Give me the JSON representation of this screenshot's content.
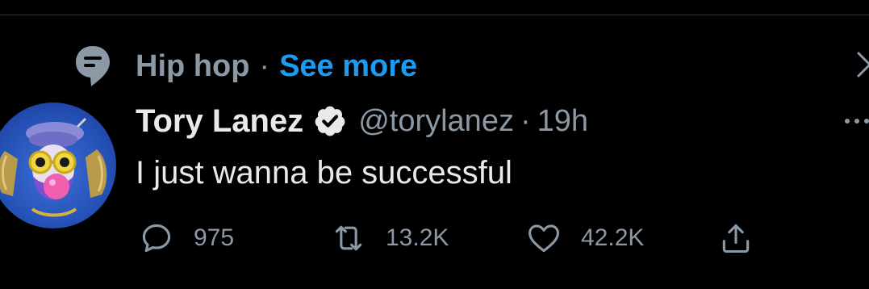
{
  "topic": {
    "name": "Hip hop",
    "separator": "·",
    "see_more": "See more"
  },
  "tweet": {
    "author_name": "Tory Lanez",
    "handle": "@torylanez",
    "separator": "·",
    "time": "19h",
    "text": "I just wanna be successful",
    "verified": true
  },
  "actions": {
    "replies": "975",
    "retweets": "13.2K",
    "likes": "42.2K"
  },
  "icons": {
    "topic": "topic-bubble-icon",
    "close": "close-icon",
    "verified": "verified-badge-icon",
    "more": "more-icon",
    "reply": "reply-icon",
    "retweet": "retweet-icon",
    "like": "heart-icon",
    "share": "share-icon"
  },
  "colors": {
    "background": "#000000",
    "primary_text": "#e7e9ea",
    "secondary_text": "#8b98a5",
    "accent": "#1d9bf0",
    "divider": "#2f3336"
  }
}
